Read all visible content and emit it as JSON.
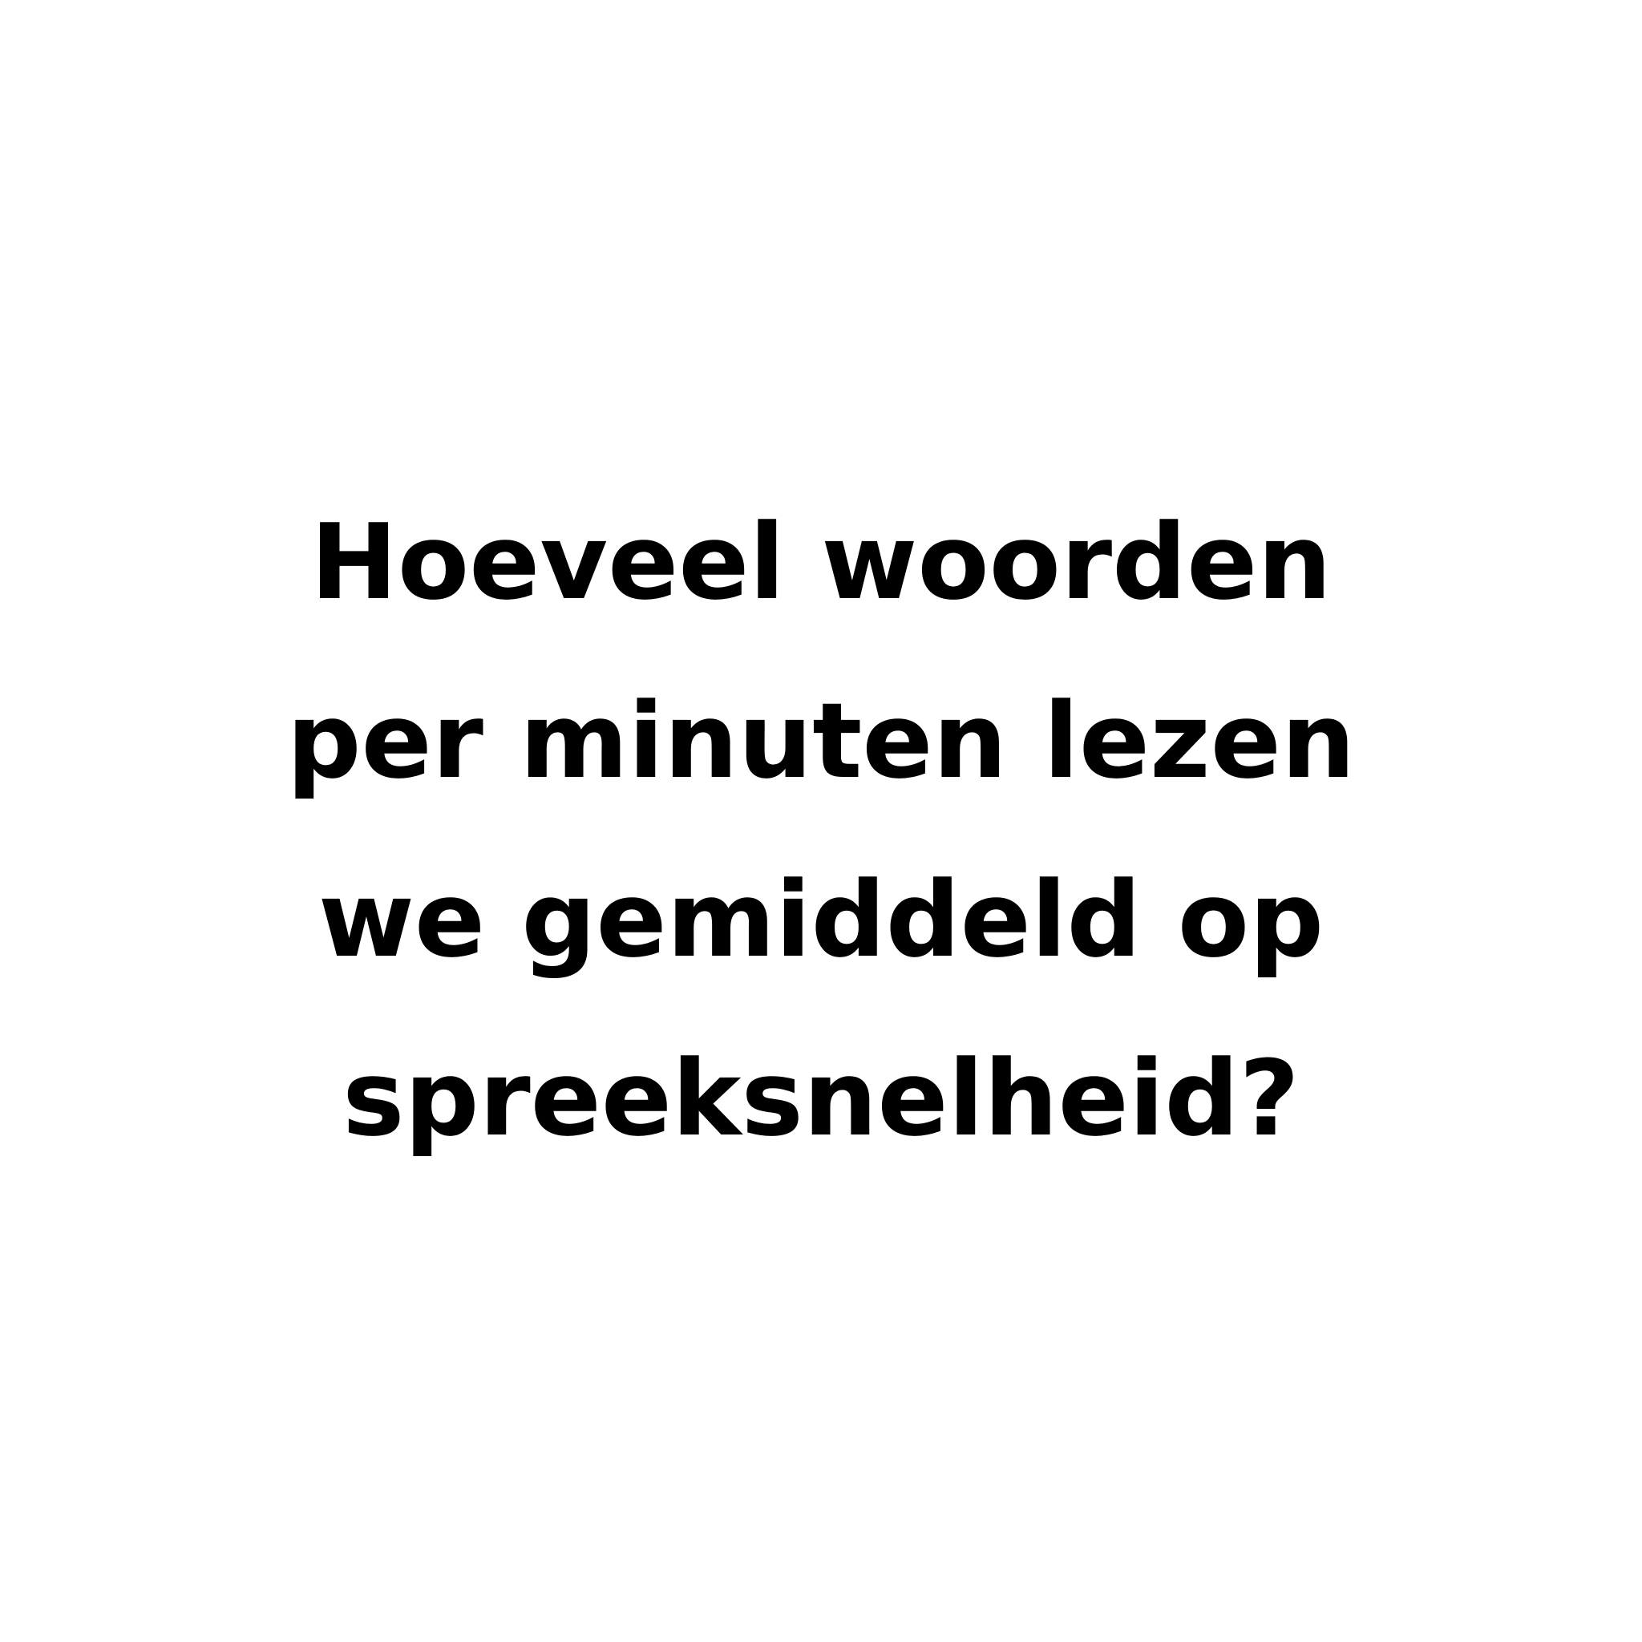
{
  "question": {
    "lines": [
      "Hoeveel woorden",
      "per minuten lezen",
      "we gemiddeld op",
      "spreeksnelheid?"
    ]
  },
  "colors": {
    "background": "#ffffff",
    "text": "#000000"
  }
}
